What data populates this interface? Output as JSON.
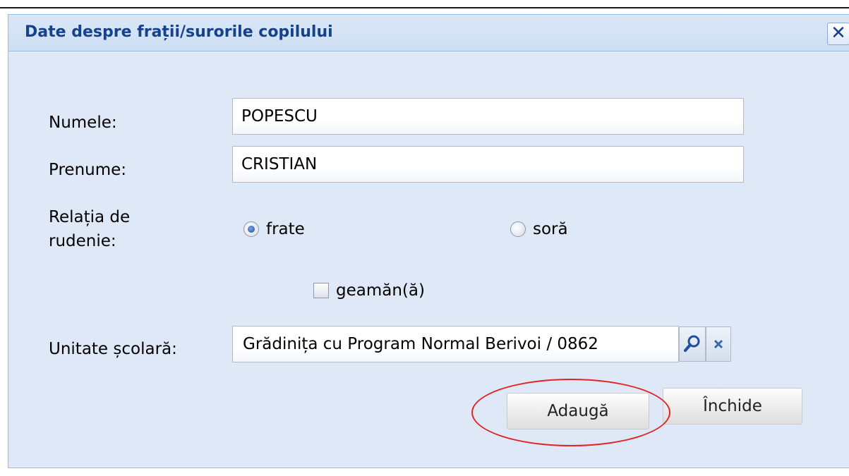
{
  "dialog": {
    "title": "Date despre frații/surorile copilului",
    "close_glyph": "✕"
  },
  "form": {
    "nume_label": "Numele:",
    "nume_value": "POPESCU",
    "prenume_label": "Prenume:",
    "prenume_value": "CRISTIAN",
    "relatia_label_line1": "Relația de",
    "relatia_label_line2": "rudenie:",
    "option_frate": "frate",
    "option_sora": "soră",
    "selected_relation": "frate",
    "geaman_label": "geamăn(ă)",
    "geaman_checked": false,
    "unitate_label": "Unitate școlară:",
    "unitate_value": "Grădinița cu Program Normal Berivoi / 0862"
  },
  "buttons": {
    "add": "Adaugă",
    "close": "Închide"
  },
  "icons": {
    "search": "search-icon",
    "clear": "clear-icon",
    "close": "close-icon"
  },
  "colors": {
    "title": "#15428b",
    "panel_bg": "#dfe8f6",
    "border": "#99bbe8",
    "annotation": "#e02424"
  }
}
